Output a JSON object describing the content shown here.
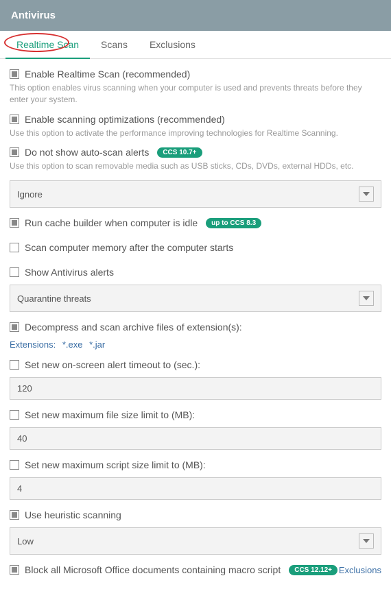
{
  "header": {
    "title": "Antivirus"
  },
  "tabs": {
    "realtime": "Realtime Scan",
    "scans": "Scans",
    "exclusions": "Exclusions"
  },
  "opt": {
    "enable_realtime": {
      "label": "Enable Realtime Scan (recommended)",
      "desc": "This option enables virus scanning when your computer is used and prevents threats before they enter your system."
    },
    "enable_opt": {
      "label": "Enable scanning optimizations (recommended)",
      "desc": "Use this option to activate the performance improving technologies for Realtime Scanning."
    },
    "no_autoscan_alerts": {
      "label": "Do not show auto-scan alerts",
      "badge": "CCS 10.7+",
      "desc": "Use this option to scan removable media such as USB sticks, CDs, DVDs, external HDDs, etc."
    },
    "autoscan_action": {
      "value": "Ignore"
    },
    "cache_builder": {
      "label": "Run cache builder when computer is idle",
      "badge": "up to CCS 8.3"
    },
    "scan_memory": {
      "label": "Scan computer memory after the computer starts"
    },
    "show_alerts": {
      "label": "Show Antivirus alerts"
    },
    "alert_action": {
      "value": "Quarantine threats"
    },
    "decompress": {
      "label": "Decompress and scan archive files of extension(s):"
    },
    "extensions": {
      "label": "Extensions:",
      "v1": "*.exe",
      "v2": "*.jar"
    },
    "timeout": {
      "label": "Set new on-screen alert timeout to (sec.):",
      "value": "120"
    },
    "filesize": {
      "label": "Set new maximum file size limit to (MB):",
      "value": "40"
    },
    "scriptsize": {
      "label": "Set new maximum script size limit to (MB):",
      "value": "4"
    },
    "heuristic": {
      "label": "Use heuristic scanning",
      "value": "Low"
    },
    "block_macro": {
      "label": "Block all Microsoft Office documents containing macro script",
      "badge": "CCS 12.12+",
      "link": "Exclusions"
    }
  }
}
